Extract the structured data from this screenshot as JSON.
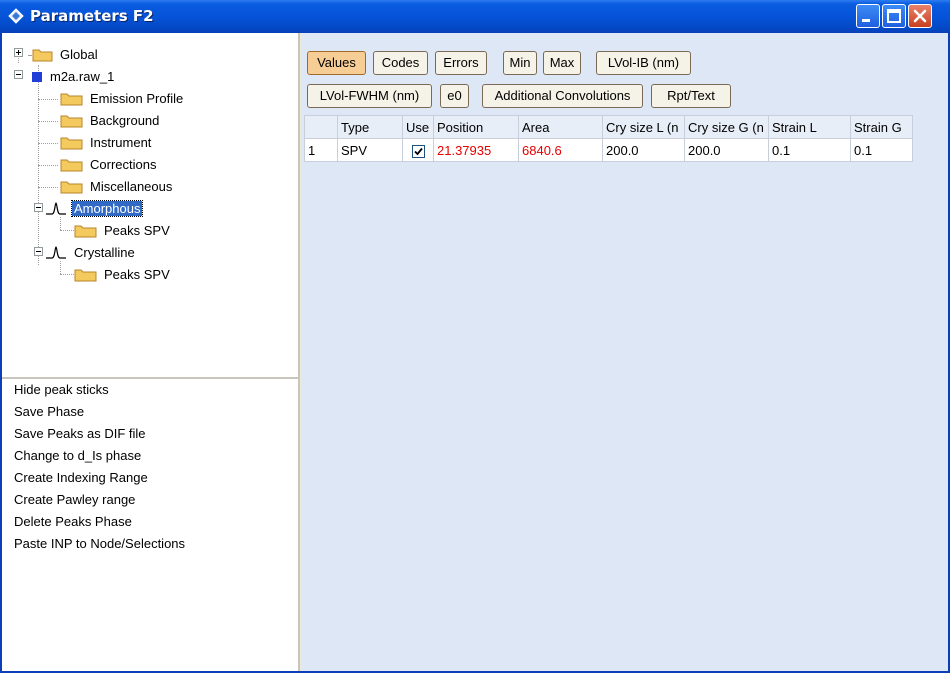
{
  "window": {
    "title": "Parameters F2"
  },
  "tree": {
    "global": "Global",
    "raw": "m2a.raw_1",
    "emission": "Emission Profile",
    "background": "Background",
    "instrument": "Instrument",
    "corrections": "Corrections",
    "misc": "Miscellaneous",
    "amorphous": "Amorphous",
    "amorphous_peaks": "Peaks SPV",
    "crystalline": "Crystalline",
    "crystalline_peaks": "Peaks SPV"
  },
  "menu": [
    "Hide peak sticks",
    "Save Phase",
    "Save Peaks as DIF file",
    "Change to d_Is phase",
    "Create Indexing Range",
    "Create Pawley range",
    "Delete Peaks Phase",
    "Paste INP to Node/Selections"
  ],
  "toolbar": {
    "values": "Values",
    "codes": "Codes",
    "errors": "Errors",
    "min": "Min",
    "max": "Max",
    "lvol_ib": "LVol-IB (nm)",
    "lvol_fwhm": "LVol-FWHM (nm)",
    "e0": "e0",
    "add_conv": "Additional Convolutions",
    "rpt": "Rpt/Text"
  },
  "table": {
    "headers": [
      "",
      "Type",
      "Use",
      "Position",
      "Area",
      "Cry size L (n",
      "Cry size G (n",
      "Strain L",
      "Strain G"
    ],
    "row": {
      "index": "1",
      "type": "SPV",
      "position": "21.37935",
      "area": "6840.6",
      "cry_l": "200.0",
      "cry_g": "200.0",
      "strain_l": "0.1",
      "strain_g": "0.1"
    }
  },
  "colors": {
    "active_button": "#f6cd94",
    "refined_value": "#e80000",
    "selection": "#316ac5"
  }
}
